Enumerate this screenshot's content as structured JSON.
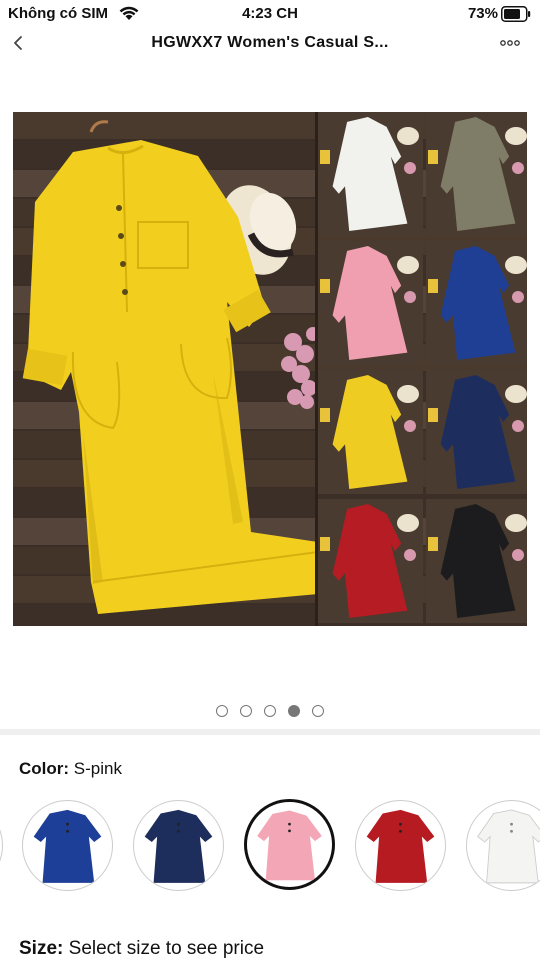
{
  "status_bar": {
    "carrier": "Không có SIM",
    "time": "4:23 CH",
    "battery": "73%"
  },
  "nav": {
    "title": "HGWXX7 Women's Casual S..."
  },
  "gallery": {
    "page_count": 5,
    "active_index": 3,
    "main_dress_color": "#f2cf1f",
    "grid_colors": [
      "#f1f1ee",
      "#7f7d67",
      "#ef9fb0",
      "#1f3f95",
      "#efcc22",
      "#1d2e5e",
      "#b51c23",
      "#1c1c1e"
    ]
  },
  "color_selector": {
    "label": "Color:",
    "value": "S-pink",
    "swatches": [
      {
        "name": "blue",
        "color": "#1e3f97"
      },
      {
        "name": "navy",
        "color": "#1d2d5c"
      },
      {
        "name": "pink",
        "color": "#f3a6b6",
        "selected": true
      },
      {
        "name": "red",
        "color": "#b61b22"
      },
      {
        "name": "white",
        "color": "#f4f4f2"
      }
    ]
  },
  "size_selector": {
    "label": "Size:",
    "value": "Select size to see price"
  }
}
